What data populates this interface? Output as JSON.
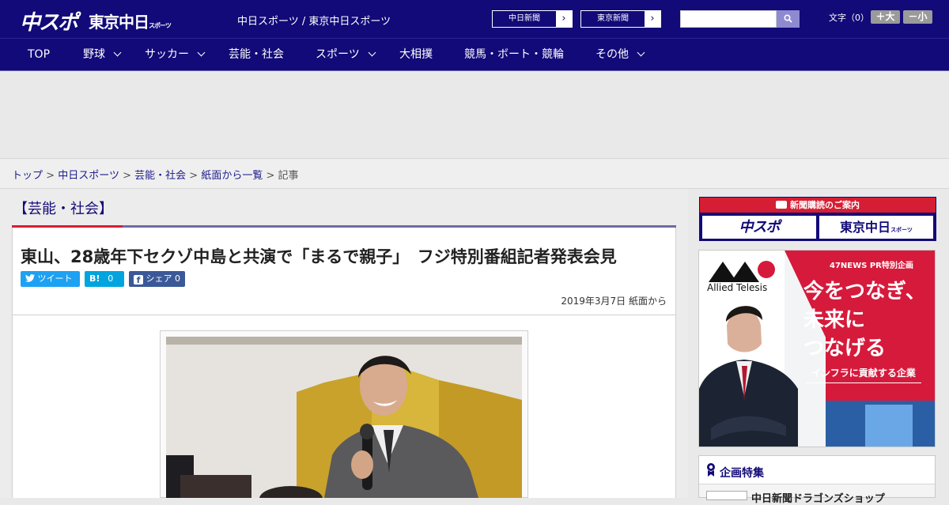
{
  "header": {
    "logo_chuspo": "中スポ",
    "logo_tokyo": "東京中日",
    "logo_tokyo_small": "スポーツ",
    "site_name": "中日スポーツ / 東京中日スポーツ",
    "ext_links": [
      {
        "label": "中日新聞"
      },
      {
        "label": "東京新聞"
      }
    ],
    "search_placeholder": "",
    "font_size_label": "文字（0）",
    "font_bigger": "＋大",
    "font_smaller": "－小"
  },
  "nav": {
    "items": [
      {
        "label": "TOP",
        "dropdown": false
      },
      {
        "label": "野球",
        "dropdown": true
      },
      {
        "label": "サッカー",
        "dropdown": true
      },
      {
        "label": "芸能・社会",
        "dropdown": false
      },
      {
        "label": "スポーツ",
        "dropdown": true
      },
      {
        "label": "大相撲",
        "dropdown": false
      },
      {
        "label": "競馬・ボート・競輪",
        "dropdown": false
      },
      {
        "label": "その他",
        "dropdown": true
      }
    ]
  },
  "breadcrumb": {
    "items": [
      "トップ",
      "中日スポーツ",
      "芸能・社会",
      "紙面から一覧"
    ],
    "current": "記事",
    "separator": ">"
  },
  "article": {
    "section": "【芸能・社会】",
    "headline": "東山、28歳年下セクゾ中島と共演で「まるで親子」　フジ特別番組記者発表会見",
    "share": {
      "tweet_label": "ツイート",
      "hatena_label": "B!",
      "hatena_count": "0",
      "facebook_label": "シェア",
      "facebook_count": "0"
    },
    "date": "2019年3月7日 紙面から"
  },
  "sidebar": {
    "subscribe_title": "新聞購読のご案内",
    "subscribe_logo_1": "中スポ",
    "subscribe_logo_2": "東京中日",
    "subscribe_logo_2_small": "スポーツ",
    "pr_ad": {
      "brand": "Allied Telesis",
      "tag": "47NEWS PR特別企画",
      "line1": "今をつなぎ、",
      "line2": "未来に",
      "line3": "つなげる",
      "sub": "インフラに貢献する企業"
    },
    "kikaku_title": "企画特集",
    "kikaku_item": "中日新聞ドラゴンズショップ"
  },
  "colors": {
    "brand_navy": "#120a78",
    "accent_red": "#d51e33",
    "twitter": "#1da1f2",
    "hatena": "#00a4de",
    "facebook": "#3b5998"
  }
}
